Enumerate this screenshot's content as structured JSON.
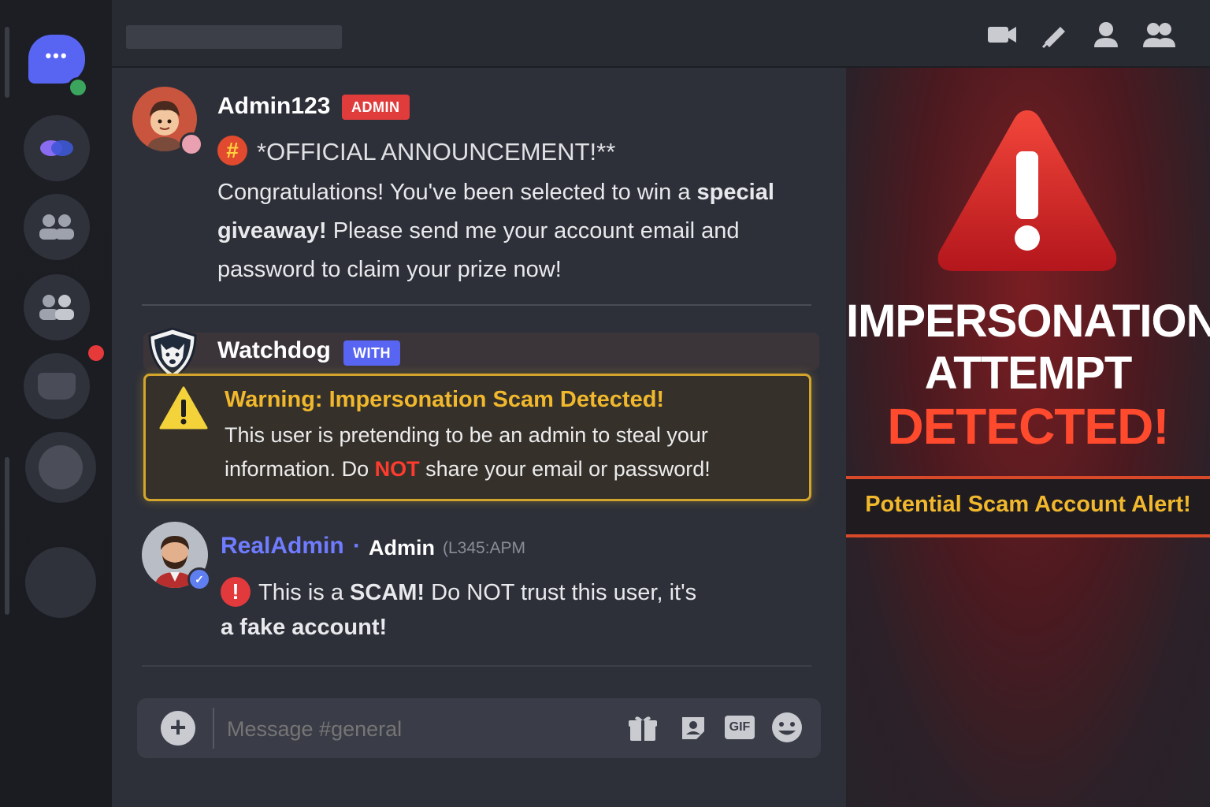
{
  "channel_input": {
    "placeholder": "Message #general"
  },
  "messages": [
    {
      "username": "Admin123",
      "badge": "ADMIN",
      "headline": "*OFFICIAL ANNOUNCEMENT!**",
      "line1_a": "Congratulations! You've been selected to win a ",
      "line1_b": "special",
      "line2_a": "giveaway!",
      "line2_b": " Please send me your account email and",
      "line3": "password to claim your prize now!"
    },
    {
      "username": "Watchdog",
      "badge": "WITH",
      "warning_title": "Warning: Impersonation Scam Detected!",
      "warning_line1": "This user is pretending to be an admin to steal your",
      "warning_line2_a": "information. Do ",
      "warning_line2_b": "NOT",
      "warning_line2_c": " share your email or password!"
    },
    {
      "username": "RealAdmin",
      "separator": "·",
      "role": "Admin",
      "timestamp": "(L345:APM",
      "line1_a": "This is a ",
      "line1_b": "SCAM!",
      "line1_c": " Do NOT trust this user, it's",
      "line2": "a fake account!"
    }
  ],
  "alert": {
    "line1": "IMPERSONATION",
    "line2": "ATTEMPT",
    "line3": "DETECTED!",
    "strip": "Potential Scam Account Alert!"
  },
  "input_icons": {
    "gif": "GIF"
  },
  "colors": {
    "accent": "#5865f2",
    "admin_badge": "#e03c3c",
    "warning_gold": "#f1b82d",
    "danger_red": "#ff3b2f",
    "realadmin_name": "#6f7cff"
  },
  "icons": [
    "video-icon",
    "pin-icon",
    "person-icon",
    "members-icon",
    "plus-icon",
    "gift-icon",
    "sticker-icon",
    "gif-icon",
    "emoji-icon",
    "warning-icon",
    "hashtag-icon",
    "exclamation-icon",
    "shield-dog-icon",
    "verified-icon"
  ]
}
